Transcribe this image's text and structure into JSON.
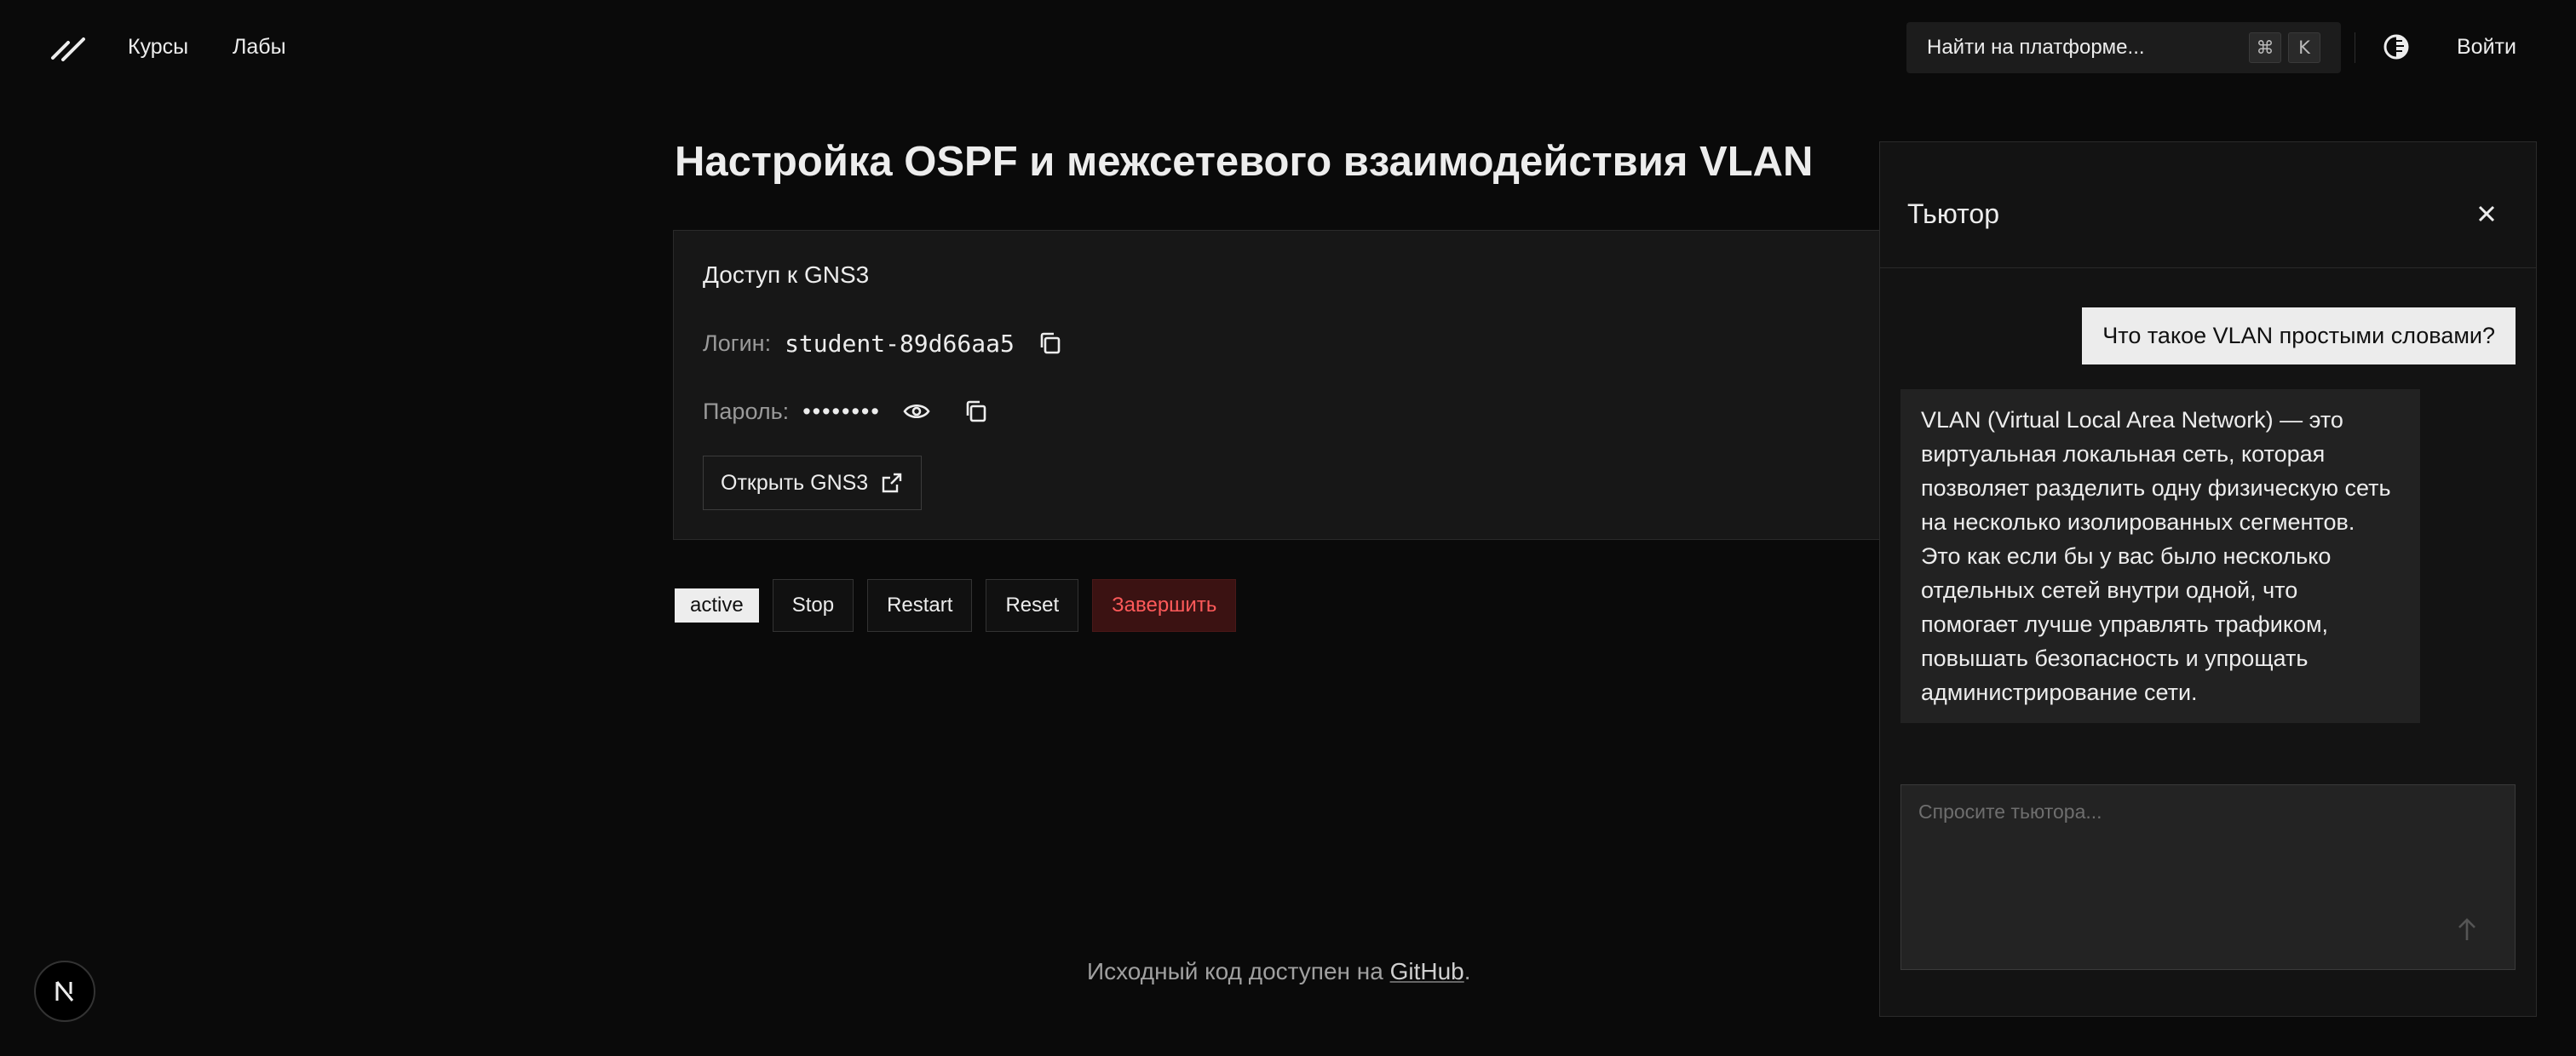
{
  "header": {
    "nav": [
      "Курсы",
      "Лабы"
    ],
    "search": {
      "placeholder": "Найти на платформе...",
      "kbd": [
        "⌘",
        "K"
      ]
    },
    "login": "Войти"
  },
  "lab": {
    "title": "Настройка OSPF и межсетевого взаимодействия VLAN",
    "card_title": "Доступ к GNS3",
    "login_label": "Логин:",
    "login_value": "student-89d66aa5",
    "password_label": "Пароль:",
    "password_mask": "••••••••",
    "open_button": "Открыть GNS3"
  },
  "controls": {
    "status": "active",
    "buttons": [
      "Stop",
      "Restart",
      "Reset",
      "Завершить"
    ]
  },
  "footer": {
    "text": "Исходный код доступен на ",
    "link": "GitHub",
    "end": "."
  },
  "tutor": {
    "title": "Тьютор",
    "user_message": "Что такое VLAN простыми словами?",
    "bot_message": "VLAN (Virtual Local Area Network) — это виртуальная локальная сеть, которая позволяет разделить одну физическую сеть на несколько изолированных сегментов. Это как если бы у вас было несколько отдельных сетей внутри одной, что помогает лучше управлять трафиком, повышать безопасность и упрощать администрирование сети.",
    "input_placeholder": "Спросите тьютора..."
  },
  "colors": {
    "background": "#0a0a0a",
    "danger_bg": "#3b1212",
    "danger_text": "#ff5a5a"
  }
}
